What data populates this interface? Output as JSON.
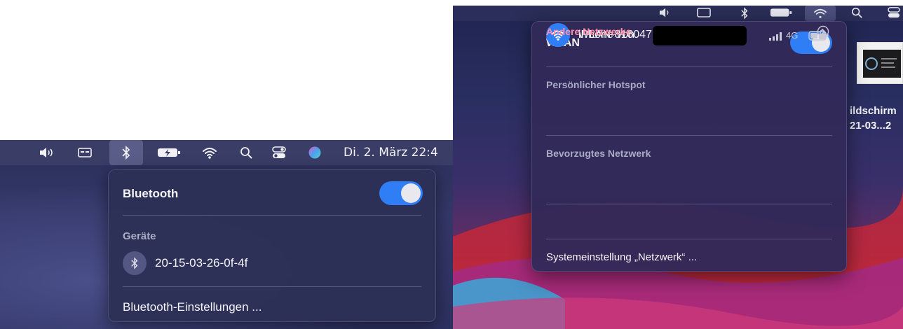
{
  "left": {
    "menubar": {
      "clock": "Di. 2. März 22:4",
      "icons": [
        "volume-icon",
        "display-icon",
        "bluetooth-icon",
        "battery-charging-icon",
        "wifi-icon",
        "search-icon",
        "control-center-icon",
        "siri-icon"
      ]
    },
    "bluetooth_menu": {
      "title": "Bluetooth",
      "toggle_on": true,
      "section_label": "Geräte",
      "devices": [
        {
          "name": "20-15-03-26-0f-4f",
          "icon": "bluetooth-icon"
        }
      ],
      "settings_label": "Bluetooth-Einstellungen ..."
    }
  },
  "right": {
    "menubar": {
      "icons": [
        "volume-icon",
        "display-icon",
        "bluetooth-icon",
        "battery-charging-icon",
        "wifi-icon",
        "search-icon",
        "control-center-icon"
      ]
    },
    "wlan_menu": {
      "title": "WLAN",
      "toggle_on": true,
      "hotspot_section": "Persönlicher Hotspot",
      "hotspot_device": "iPhone von",
      "hotspot_signal": "4G",
      "preferred_section": "Bevorzugtes Netzwerk",
      "preferred_network": "WLAN-816047",
      "other_networks": "Andere Netzwerke",
      "settings_label": "Systemeinstellung „Netzwerk“ ..."
    },
    "desktop_file": {
      "label_line1": "ildschirm",
      "label_line2": "21-03...2"
    }
  },
  "colors": {
    "accent": "#2f7ef6",
    "other_networks": "#ff8fa8"
  }
}
